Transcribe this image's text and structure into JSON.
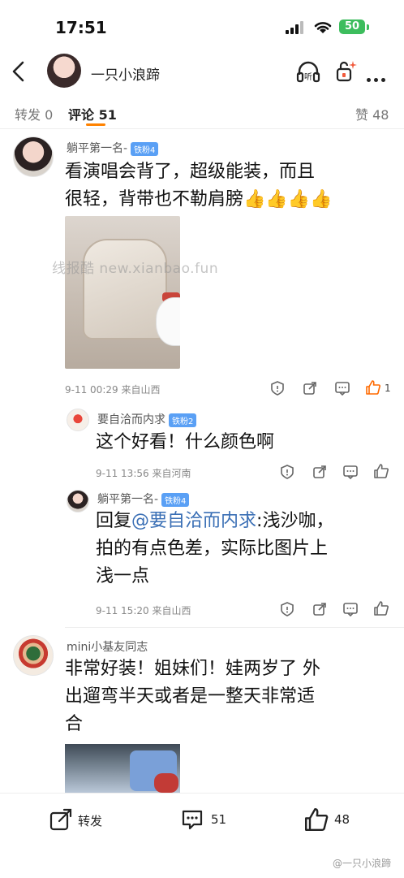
{
  "status": {
    "time": "17:51",
    "battery": "50"
  },
  "header": {
    "nickname": "一只小浪蹄",
    "listen_label": "听"
  },
  "tabs": {
    "repost": "转发 0",
    "comments": "评论 51",
    "likes": "赞 48"
  },
  "comments": [
    {
      "name": "躺平第一名-",
      "badge": "铁粉4",
      "text": [
        "看演唱会背了，超级能装，而且",
        "很轻，背带也不勒肩膀👍👍👍👍"
      ],
      "meta": "9-11 00:29  来自山西",
      "like_count": "1",
      "replies": [
        {
          "name": "要自洽而内求",
          "badge": "铁粉2",
          "text": "这个好看！什么颜色啊",
          "meta": "9-11 13:56  来自河南"
        },
        {
          "name": "躺平第一名-",
          "badge": "铁粉4",
          "reply_prefix": "回复",
          "mention": "@要自洽而内求",
          "text_after_mention": ":浅沙咖，",
          "text": [
            "拍的有点色差，实际比图片上",
            "浅一点"
          ],
          "meta": "9-11 15:20  来自山西"
        }
      ]
    },
    {
      "name": "mini小基友同志",
      "text": [
        "非常好装！姐妹们！娃两岁了 外",
        "出遛弯半天或者是一整天非常适",
        "合"
      ]
    }
  ],
  "watermark": "线报酷 new.xianbao.fun",
  "bottom_bar": {
    "repost": "转发",
    "comments": "51",
    "likes": "48"
  },
  "footer_watermark": "@一只小浪蹄"
}
